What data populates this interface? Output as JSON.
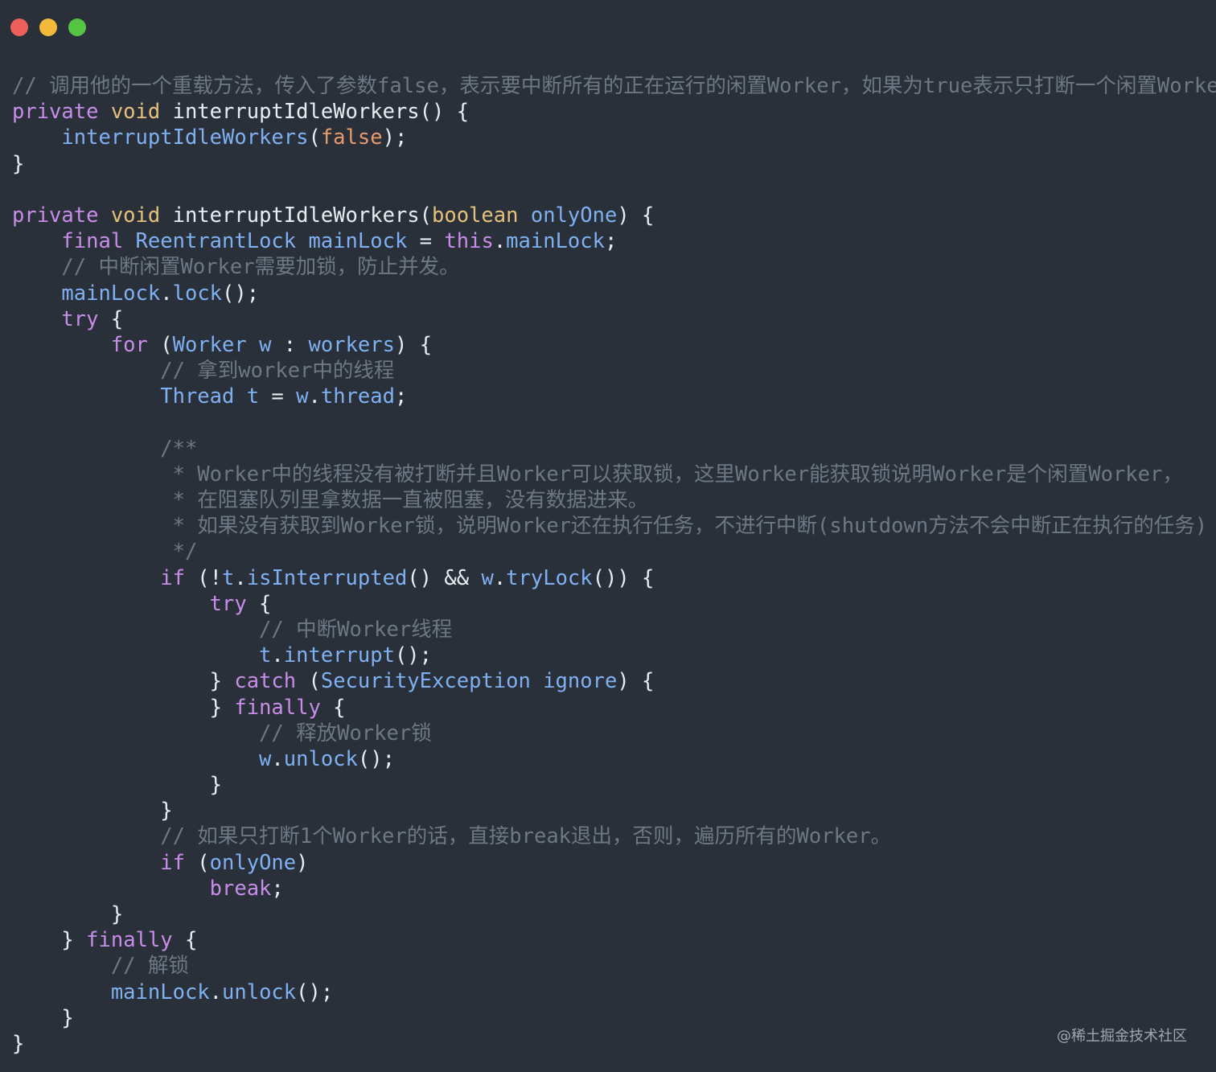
{
  "window": {
    "traffic_lights": [
      {
        "name": "close",
        "color": "#ec5f5a"
      },
      {
        "name": "minimize",
        "color": "#f2b93a"
      },
      {
        "name": "maximize",
        "color": "#56c443"
      }
    ]
  },
  "code_lines": [
    [
      {
        "t": "// 调用他的一个重载方法，传入了参数false，表示要中断所有的正在运行的闲置Worker，如果为true表示只打断一个闲置Worker。",
        "c": "cm"
      }
    ],
    [
      {
        "t": "private",
        "c": "kw"
      },
      {
        "t": " ",
        "c": ""
      },
      {
        "t": "void",
        "c": "ty"
      },
      {
        "t": " interruptIdleWorkers() {",
        "c": "id"
      }
    ],
    [
      {
        "t": "    ",
        "c": ""
      },
      {
        "t": "interruptIdleWorkers",
        "c": "fn"
      },
      {
        "t": "(",
        "c": "id"
      },
      {
        "t": "false",
        "c": "bo"
      },
      {
        "t": ");",
        "c": "id"
      }
    ],
    [
      {
        "t": "}",
        "c": "id"
      }
    ],
    [
      {
        "t": "",
        "c": ""
      }
    ],
    [
      {
        "t": "private",
        "c": "kw"
      },
      {
        "t": " ",
        "c": ""
      },
      {
        "t": "void",
        "c": "ty"
      },
      {
        "t": " interruptIdleWorkers(",
        "c": "id"
      },
      {
        "t": "boolean",
        "c": "ty"
      },
      {
        "t": " ",
        "c": ""
      },
      {
        "t": "onlyOne",
        "c": "fn"
      },
      {
        "t": ") {",
        "c": "id"
      }
    ],
    [
      {
        "t": "    ",
        "c": ""
      },
      {
        "t": "final",
        "c": "kw"
      },
      {
        "t": " ",
        "c": ""
      },
      {
        "t": "ReentrantLock",
        "c": "fn"
      },
      {
        "t": " ",
        "c": ""
      },
      {
        "t": "mainLock",
        "c": "fn"
      },
      {
        "t": " = ",
        "c": "id"
      },
      {
        "t": "this",
        "c": "th"
      },
      {
        "t": ".",
        "c": "id"
      },
      {
        "t": "mainLock",
        "c": "fn"
      },
      {
        "t": ";",
        "c": "id"
      }
    ],
    [
      {
        "t": "    ",
        "c": ""
      },
      {
        "t": "// 中断闲置Worker需要加锁，防止并发。",
        "c": "cm"
      }
    ],
    [
      {
        "t": "    ",
        "c": ""
      },
      {
        "t": "mainLock",
        "c": "fn"
      },
      {
        "t": ".",
        "c": "id"
      },
      {
        "t": "lock",
        "c": "fn"
      },
      {
        "t": "();",
        "c": "id"
      }
    ],
    [
      {
        "t": "    ",
        "c": ""
      },
      {
        "t": "try",
        "c": "kw"
      },
      {
        "t": " {",
        "c": "id"
      }
    ],
    [
      {
        "t": "        ",
        "c": ""
      },
      {
        "t": "for",
        "c": "kw"
      },
      {
        "t": " (",
        "c": "id"
      },
      {
        "t": "Worker",
        "c": "fn"
      },
      {
        "t": " ",
        "c": ""
      },
      {
        "t": "w",
        "c": "fn"
      },
      {
        "t": " : ",
        "c": "id"
      },
      {
        "t": "workers",
        "c": "fn"
      },
      {
        "t": ") {",
        "c": "id"
      }
    ],
    [
      {
        "t": "            ",
        "c": ""
      },
      {
        "t": "// 拿到worker中的线程",
        "c": "cm"
      }
    ],
    [
      {
        "t": "            ",
        "c": ""
      },
      {
        "t": "Thread",
        "c": "fn"
      },
      {
        "t": " ",
        "c": ""
      },
      {
        "t": "t",
        "c": "fn"
      },
      {
        "t": " = ",
        "c": "id"
      },
      {
        "t": "w",
        "c": "fn"
      },
      {
        "t": ".",
        "c": "id"
      },
      {
        "t": "thread",
        "c": "fn"
      },
      {
        "t": ";",
        "c": "id"
      }
    ],
    [
      {
        "t": "",
        "c": ""
      }
    ],
    [
      {
        "t": "            ",
        "c": ""
      },
      {
        "t": "/**",
        "c": "cm"
      }
    ],
    [
      {
        "t": "             ",
        "c": ""
      },
      {
        "t": "* Worker中的线程没有被打断并且Worker可以获取锁，这里Worker能获取锁说明Worker是个闲置Worker，",
        "c": "cm"
      }
    ],
    [
      {
        "t": "             ",
        "c": ""
      },
      {
        "t": "* 在阻塞队列里拿数据一直被阻塞，没有数据进来。",
        "c": "cm"
      }
    ],
    [
      {
        "t": "             ",
        "c": ""
      },
      {
        "t": "* 如果没有获取到Worker锁，说明Worker还在执行任务，不进行中断(shutdown方法不会中断正在执行的任务)",
        "c": "cm"
      }
    ],
    [
      {
        "t": "             ",
        "c": ""
      },
      {
        "t": "*/",
        "c": "cm"
      }
    ],
    [
      {
        "t": "            ",
        "c": ""
      },
      {
        "t": "if",
        "c": "kw"
      },
      {
        "t": " (!",
        "c": "id"
      },
      {
        "t": "t",
        "c": "fn"
      },
      {
        "t": ".",
        "c": "id"
      },
      {
        "t": "isInterrupted",
        "c": "fn"
      },
      {
        "t": "() && ",
        "c": "id"
      },
      {
        "t": "w",
        "c": "fn"
      },
      {
        "t": ".",
        "c": "id"
      },
      {
        "t": "tryLock",
        "c": "fn"
      },
      {
        "t": "()) {",
        "c": "id"
      }
    ],
    [
      {
        "t": "                ",
        "c": ""
      },
      {
        "t": "try",
        "c": "kw"
      },
      {
        "t": " {",
        "c": "id"
      }
    ],
    [
      {
        "t": "                    ",
        "c": ""
      },
      {
        "t": "// 中断Worker线程",
        "c": "cm"
      }
    ],
    [
      {
        "t": "                    ",
        "c": ""
      },
      {
        "t": "t",
        "c": "fn"
      },
      {
        "t": ".",
        "c": "id"
      },
      {
        "t": "interrupt",
        "c": "fn"
      },
      {
        "t": "();",
        "c": "id"
      }
    ],
    [
      {
        "t": "                ",
        "c": ""
      },
      {
        "t": "} ",
        "c": "id"
      },
      {
        "t": "catch",
        "c": "kw"
      },
      {
        "t": " (",
        "c": "id"
      },
      {
        "t": "SecurityException",
        "c": "fn"
      },
      {
        "t": " ",
        "c": ""
      },
      {
        "t": "ignore",
        "c": "fn"
      },
      {
        "t": ") {",
        "c": "id"
      }
    ],
    [
      {
        "t": "                ",
        "c": ""
      },
      {
        "t": "} ",
        "c": "id"
      },
      {
        "t": "finally",
        "c": "kw"
      },
      {
        "t": " {",
        "c": "id"
      }
    ],
    [
      {
        "t": "                    ",
        "c": ""
      },
      {
        "t": "// 释放Worker锁",
        "c": "cm"
      }
    ],
    [
      {
        "t": "                    ",
        "c": ""
      },
      {
        "t": "w",
        "c": "fn"
      },
      {
        "t": ".",
        "c": "id"
      },
      {
        "t": "unlock",
        "c": "fn"
      },
      {
        "t": "();",
        "c": "id"
      }
    ],
    [
      {
        "t": "                ",
        "c": ""
      },
      {
        "t": "}",
        "c": "id"
      }
    ],
    [
      {
        "t": "            ",
        "c": ""
      },
      {
        "t": "}",
        "c": "id"
      }
    ],
    [
      {
        "t": "            ",
        "c": ""
      },
      {
        "t": "// 如果只打断1个Worker的话，直接break退出，否则，遍历所有的Worker。",
        "c": "cm"
      }
    ],
    [
      {
        "t": "            ",
        "c": ""
      },
      {
        "t": "if",
        "c": "kw"
      },
      {
        "t": " (",
        "c": "id"
      },
      {
        "t": "onlyOne",
        "c": "fn"
      },
      {
        "t": ")",
        "c": "id"
      }
    ],
    [
      {
        "t": "                ",
        "c": ""
      },
      {
        "t": "break",
        "c": "kw"
      },
      {
        "t": ";",
        "c": "id"
      }
    ],
    [
      {
        "t": "        ",
        "c": ""
      },
      {
        "t": "}",
        "c": "id"
      }
    ],
    [
      {
        "t": "    ",
        "c": ""
      },
      {
        "t": "} ",
        "c": "id"
      },
      {
        "t": "finally",
        "c": "kw"
      },
      {
        "t": " {",
        "c": "id"
      }
    ],
    [
      {
        "t": "        ",
        "c": ""
      },
      {
        "t": "// 解锁",
        "c": "cm"
      }
    ],
    [
      {
        "t": "        ",
        "c": ""
      },
      {
        "t": "mainLock",
        "c": "fn"
      },
      {
        "t": ".",
        "c": "id"
      },
      {
        "t": "unlock",
        "c": "fn"
      },
      {
        "t": "();",
        "c": "id"
      }
    ],
    [
      {
        "t": "    ",
        "c": ""
      },
      {
        "t": "}",
        "c": "id"
      }
    ],
    [
      {
        "t": "}",
        "c": "id"
      }
    ]
  ],
  "watermark": "@稀土掘金技术社区"
}
